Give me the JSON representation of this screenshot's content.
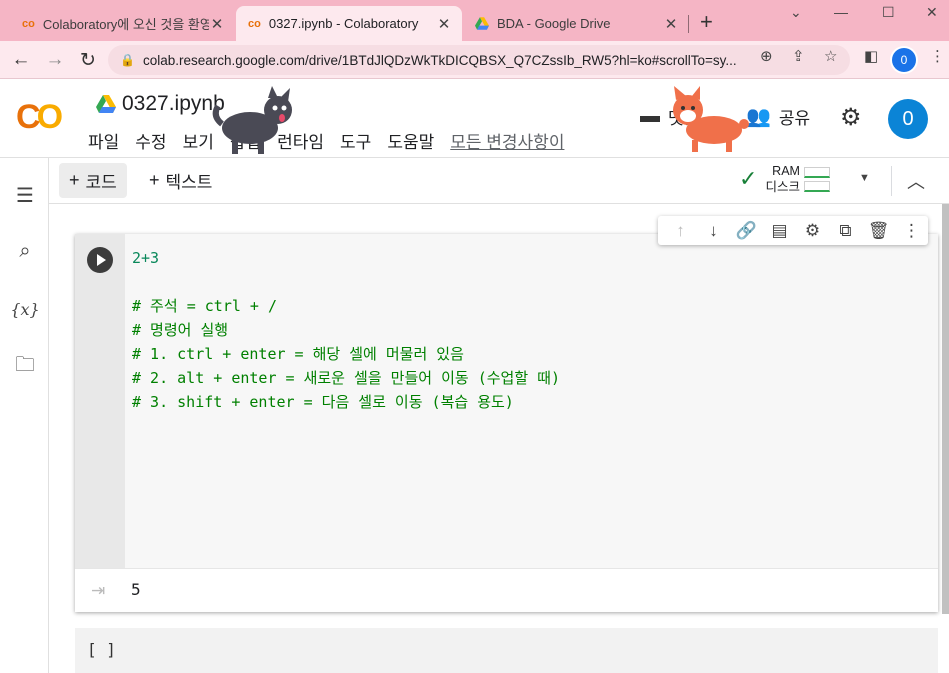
{
  "browser": {
    "tabs": [
      {
        "title": "Colaboratory에 오신 것을 환영",
        "active": false,
        "favicon": "colab-icon"
      },
      {
        "title": "0327.ipynb - Colaboratory",
        "active": true,
        "favicon": "colab-icon"
      },
      {
        "title": "BDA - Google Drive",
        "active": false,
        "favicon": "drive-icon"
      }
    ],
    "new_tab": "+",
    "window_controls": [
      "⌄",
      "—",
      "☐",
      "✕"
    ],
    "url": "colab.research.google.com/drive/1BTdJlQDzWkTkDICQBSX_Q7CZssIb_RW5?hl=ko#scrollTo=sy...",
    "profile_initial": "0"
  },
  "colab": {
    "logo": "CO",
    "notebook_name": "0327.ipynb",
    "menu": [
      "파일",
      "수정",
      "보기",
      "삽입",
      "런타임",
      "도구",
      "도움말"
    ],
    "all_changes": "모든 변경사항이",
    "comment_label": "댓글",
    "share_label": "공유",
    "avatar_initial": "0"
  },
  "toolbar": {
    "code_label": "코드",
    "text_label": "텍스트",
    "ram_label": "RAM",
    "disk_label": "디스크"
  },
  "cell": {
    "code_lines": [
      "2+3",
      "",
      "# 주석 = ctrl + /",
      "# 명령어 실행",
      "# 1. ctrl + enter = 해당 셀에 머물러 있음",
      "# 2. alt + enter = 새로운 셀을 만들어 이동 (수업할 때)",
      "# 3. shift + enter = 다음 셀로 이동 (복습 용도)"
    ],
    "output": "5"
  },
  "cell2": {
    "content": "[ ]"
  },
  "colors": {
    "accent": "#1a73e8",
    "comment": "#008000",
    "tabstrip": "#f5b5c5"
  }
}
